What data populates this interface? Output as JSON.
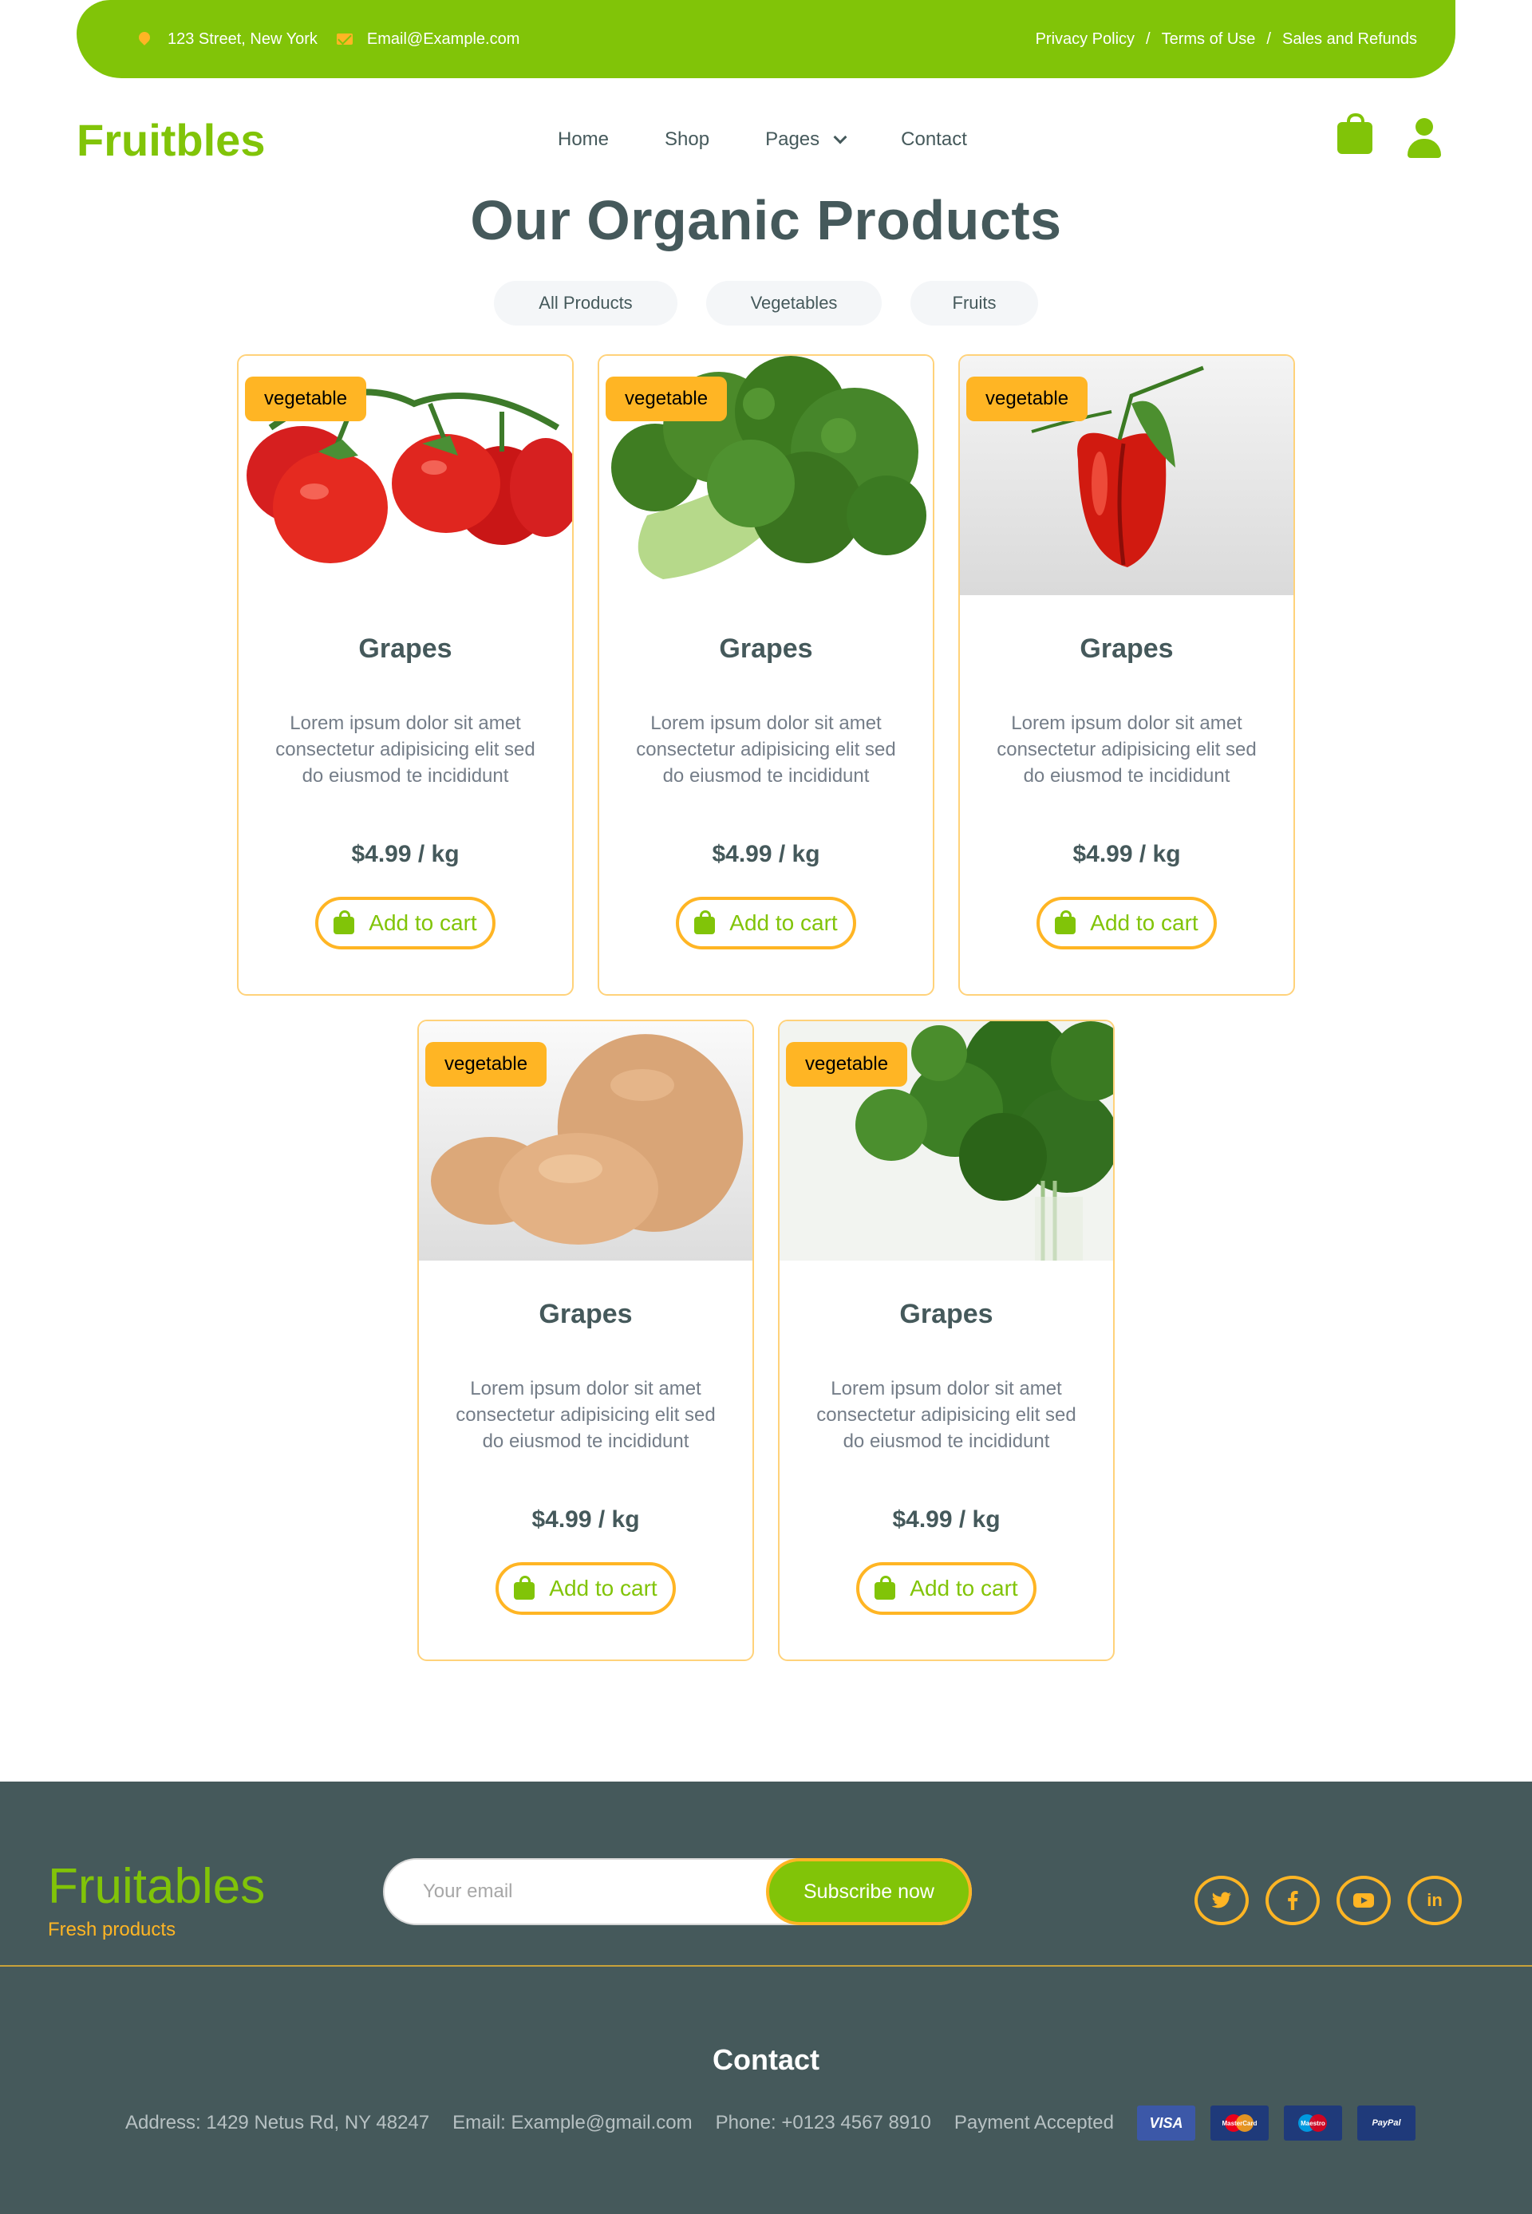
{
  "topbar": {
    "address": "123 Street, New York",
    "email": "Email@Example.com",
    "links": [
      "Privacy Policy",
      "Terms of Use",
      "Sales and Refunds"
    ],
    "separator": "/"
  },
  "nav": {
    "logo": "Fruitbles",
    "menu": [
      "Home",
      "Shop",
      "Pages",
      "Contact"
    ]
  },
  "section": {
    "title": "Our Organic Products",
    "filters": [
      "All Products",
      "Vegetables",
      "Fruits"
    ]
  },
  "products": [
    {
      "badge": "vegetable",
      "name": "Grapes",
      "desc": "Lorem ipsum dolor sit amet consectetur adipisicing elit sed do eiusmod te incididunt",
      "price": "$4.99 / kg",
      "cta": "Add to cart",
      "image": "tomatoes"
    },
    {
      "badge": "vegetable",
      "name": "Grapes",
      "desc": "Lorem ipsum dolor sit amet consectetur adipisicing elit sed do eiusmod te incididunt",
      "price": "$4.99 / kg",
      "cta": "Add to cart",
      "image": "broccoli"
    },
    {
      "badge": "vegetable",
      "name": "Grapes",
      "desc": "Lorem ipsum dolor sit amet consectetur adipisicing elit sed do eiusmod te incididunt",
      "price": "$4.99 / kg",
      "cta": "Add to cart",
      "image": "red-pepper"
    },
    {
      "badge": "vegetable",
      "name": "Grapes",
      "desc": "Lorem ipsum dolor sit amet consectetur adipisicing elit sed do eiusmod te incididunt",
      "price": "$4.99 / kg",
      "cta": "Add to cart",
      "image": "potatoes"
    },
    {
      "badge": "vegetable",
      "name": "Grapes",
      "desc": "Lorem ipsum dolor sit amet consectetur adipisicing elit sed do eiusmod te incididunt",
      "price": "$4.99 / kg",
      "cta": "Add to cart",
      "image": "parsley"
    }
  ],
  "footer": {
    "logo": "Fruitables",
    "tagline": "Fresh products",
    "email_placeholder": "Your email",
    "subscribe": "Subscribe now",
    "socials": [
      "twitter-icon",
      "facebook-icon",
      "youtube-icon",
      "linkedin-icon"
    ],
    "contact_title": "Contact",
    "address": "Address: 1429 Netus Rd, NY 48247",
    "email": "Email: Example@gmail.com",
    "phone": "Phone: +0123 4567 8910",
    "payment": "Payment Accepted",
    "payment_methods": [
      "VISA",
      "MasterCard",
      "Maestro",
      "PayPal"
    ]
  },
  "colors": {
    "primary": "#81c408",
    "secondary": "#ffb524",
    "dark": "#45595b"
  }
}
